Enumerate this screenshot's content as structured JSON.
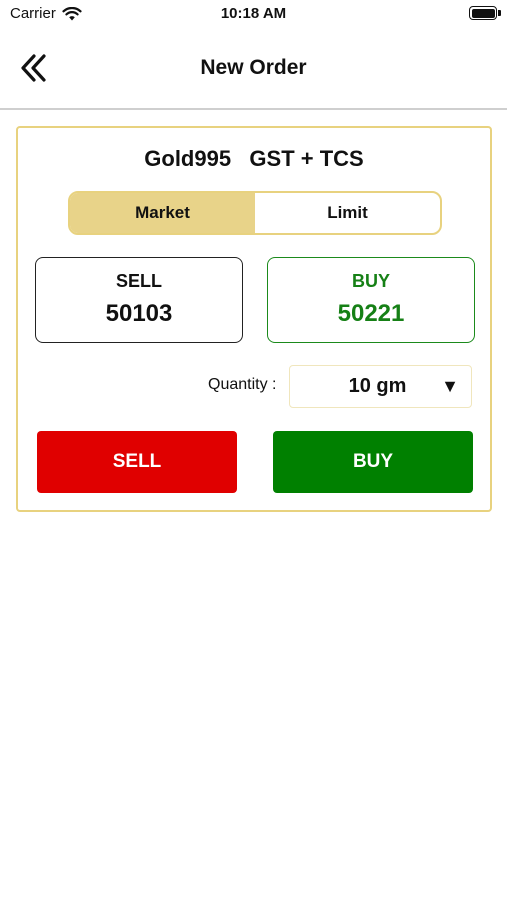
{
  "status_bar": {
    "carrier": "Carrier",
    "time": "10:18 AM"
  },
  "nav": {
    "title": "New Order",
    "back_icon": "double-chevron-left-icon"
  },
  "order": {
    "product": "Gold995   GST + TCS",
    "order_types": [
      {
        "label": "Market",
        "selected": true
      },
      {
        "label": "Limit",
        "selected": false
      }
    ],
    "sell_price": {
      "label": "SELL",
      "value": "50103"
    },
    "buy_price": {
      "label": "BUY",
      "value": "50221"
    },
    "quantity": {
      "label": "Quantity :",
      "value": "10 gm",
      "caret": "▼"
    },
    "actions": {
      "sell_label": "SELL",
      "buy_label": "BUY"
    }
  },
  "colors": {
    "accent_gold": "#e8d389",
    "sell_red": "#e00000",
    "buy_green": "#008000"
  }
}
